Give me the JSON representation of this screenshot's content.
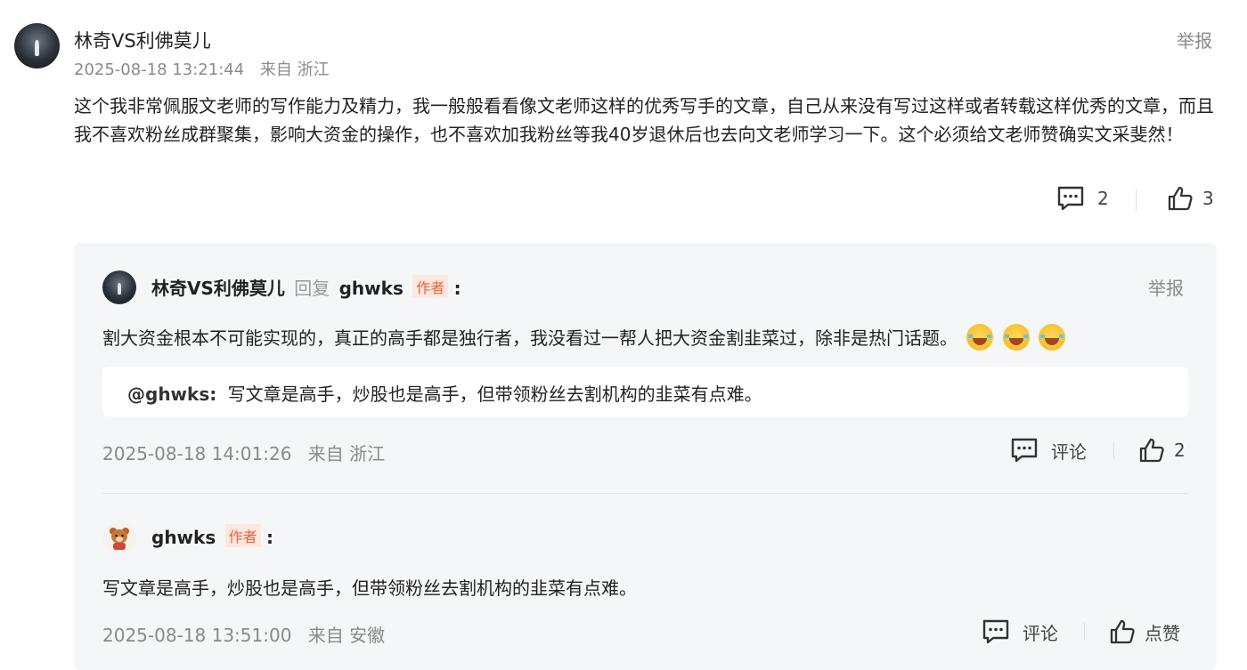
{
  "comment": {
    "username": "林奇VS利佛莫儿",
    "time": "2025-08-18 13:21:44",
    "location": "来自 浙江",
    "report": "举报",
    "text": "这个我非常佩服文老师的写作能力及精力，我一般般看看像文老师这样的优秀写手的文章，自己从来没有写过这样或者转载这样优秀的文章，而且我不喜欢粉丝成群聚集，影响大资金的操作，也不喜欢加我粉丝等我40岁退休后也去向文老师学习一下。这个必须给文老师赞确实文采斐然！",
    "comment_count": "2",
    "like_count": "3"
  },
  "replies": [
    {
      "username": "林奇VS利佛莫儿",
      "reply_word": "回复",
      "target": "ghwks",
      "target_tag": "作者",
      "colon": ":",
      "report": "举报",
      "text": "割大资金根本不可能实现的，真正的高手都是独行者，我没看过一帮人把大资金割韭菜过，除非是热门话题。",
      "emojis": [
        "laugh-cry-emoji",
        "laugh-cry-emoji",
        "laugh-cry-emoji"
      ],
      "quote_user": "@ghwks:",
      "quote_text": "写文章是高手，炒股也是高手，但带领粉丝去割机构的韭菜有点难。",
      "time": "2025-08-18 14:01:26",
      "location": "来自 浙江",
      "comment_label": "评论",
      "like_count": "2"
    },
    {
      "username": "ghwks",
      "tag": "作者",
      "colon": ":",
      "text": "写文章是高手，炒股也是高手，但带领粉丝去割机构的韭菜有点难。",
      "time": "2025-08-18 13:51:00",
      "location": "来自 安徽",
      "comment_label": "评论",
      "like_label": "点赞"
    }
  ]
}
